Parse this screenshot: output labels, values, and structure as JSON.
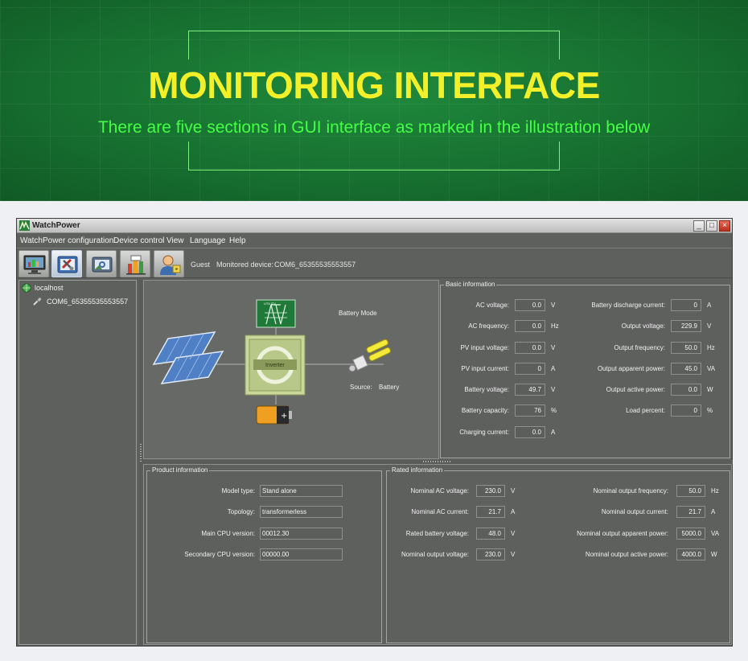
{
  "banner": {
    "title": "MONITORING INTERFACE",
    "subtitle": "There are five sections in GUI interface as marked in the illustration below"
  },
  "window": {
    "title": "WatchPower",
    "controls": {
      "minimize": "_",
      "maximize": "□",
      "close": "×"
    }
  },
  "menu": [
    "WatchPower configuration",
    "Device control",
    "View",
    "Language",
    "Help"
  ],
  "toolbar": {
    "buttons": [
      "monitor-icon",
      "tools-icon",
      "device-photo-icon",
      "data-chart-icon",
      "user-icon"
    ],
    "status": {
      "user": "Guest",
      "monitored_label": "Monitored device:",
      "device": "COM6_65355535553557"
    }
  },
  "tree": {
    "root": "localhost",
    "child": "COM6_65355535553557"
  },
  "diagram": {
    "mode": "Battery Mode",
    "source_label": "Source:",
    "source_value": "Battery",
    "inverter_label": "Inverter",
    "utility_label": "UTILITY"
  },
  "basic_info": {
    "title": "Basic information",
    "left": [
      {
        "label": "AC voltage:",
        "value": "0.0",
        "unit": "V"
      },
      {
        "label": "AC frequency:",
        "value": "0.0",
        "unit": "Hz"
      },
      {
        "label": "PV input voltage:",
        "value": "0.0",
        "unit": "V"
      },
      {
        "label": "PV input current:",
        "value": "0",
        "unit": "A"
      },
      {
        "label": "Battery voltage:",
        "value": "49.7",
        "unit": "V"
      },
      {
        "label": "Battery capacity:",
        "value": "76",
        "unit": "%"
      },
      {
        "label": "Charging current:",
        "value": "0.0",
        "unit": "A"
      }
    ],
    "right": [
      {
        "label": "Battery discharge current:",
        "value": "0",
        "unit": "A"
      },
      {
        "label": "Output voltage:",
        "value": "229.9",
        "unit": "V"
      },
      {
        "label": "Output frequency:",
        "value": "50.0",
        "unit": "Hz"
      },
      {
        "label": "Output apparent power:",
        "value": "45.0",
        "unit": "VA"
      },
      {
        "label": "Output active power:",
        "value": "0.0",
        "unit": "W"
      },
      {
        "label": "Load percent:",
        "value": "0",
        "unit": "%"
      }
    ]
  },
  "product_info": {
    "title": "Product information",
    "rows": [
      {
        "label": "Model type:",
        "value": "Stand alone"
      },
      {
        "label": "Topology:",
        "value": "transformerless"
      },
      {
        "label": "Main CPU version:",
        "value": "00012.30"
      },
      {
        "label": "Secondary CPU version:",
        "value": "00000.00"
      }
    ]
  },
  "rated_info": {
    "title": "Rated information",
    "left": [
      {
        "label": "Nominal AC voltage:",
        "value": "230.0",
        "unit": "V"
      },
      {
        "label": "Nominal AC current:",
        "value": "21.7",
        "unit": "A"
      },
      {
        "label": "Rated battery voltage:",
        "value": "48.0",
        "unit": "V"
      },
      {
        "label": "Nominal output voltage:",
        "value": "230.0",
        "unit": "V"
      }
    ],
    "right": [
      {
        "label": "Nominal output frequency:",
        "value": "50.0",
        "unit": "Hz"
      },
      {
        "label": "Nominal output current:",
        "value": "21.7",
        "unit": "A"
      },
      {
        "label": "Nominal output apparent power:",
        "value": "5000.0",
        "unit": "VA"
      },
      {
        "label": "Nominal output active power:",
        "value": "4000.0",
        "unit": "W"
      }
    ]
  },
  "colors": {
    "banner_green": "#177030",
    "title_yellow": "#f3f02a",
    "subtitle_green": "#44ff44",
    "panel_gray": "#5e605e"
  }
}
